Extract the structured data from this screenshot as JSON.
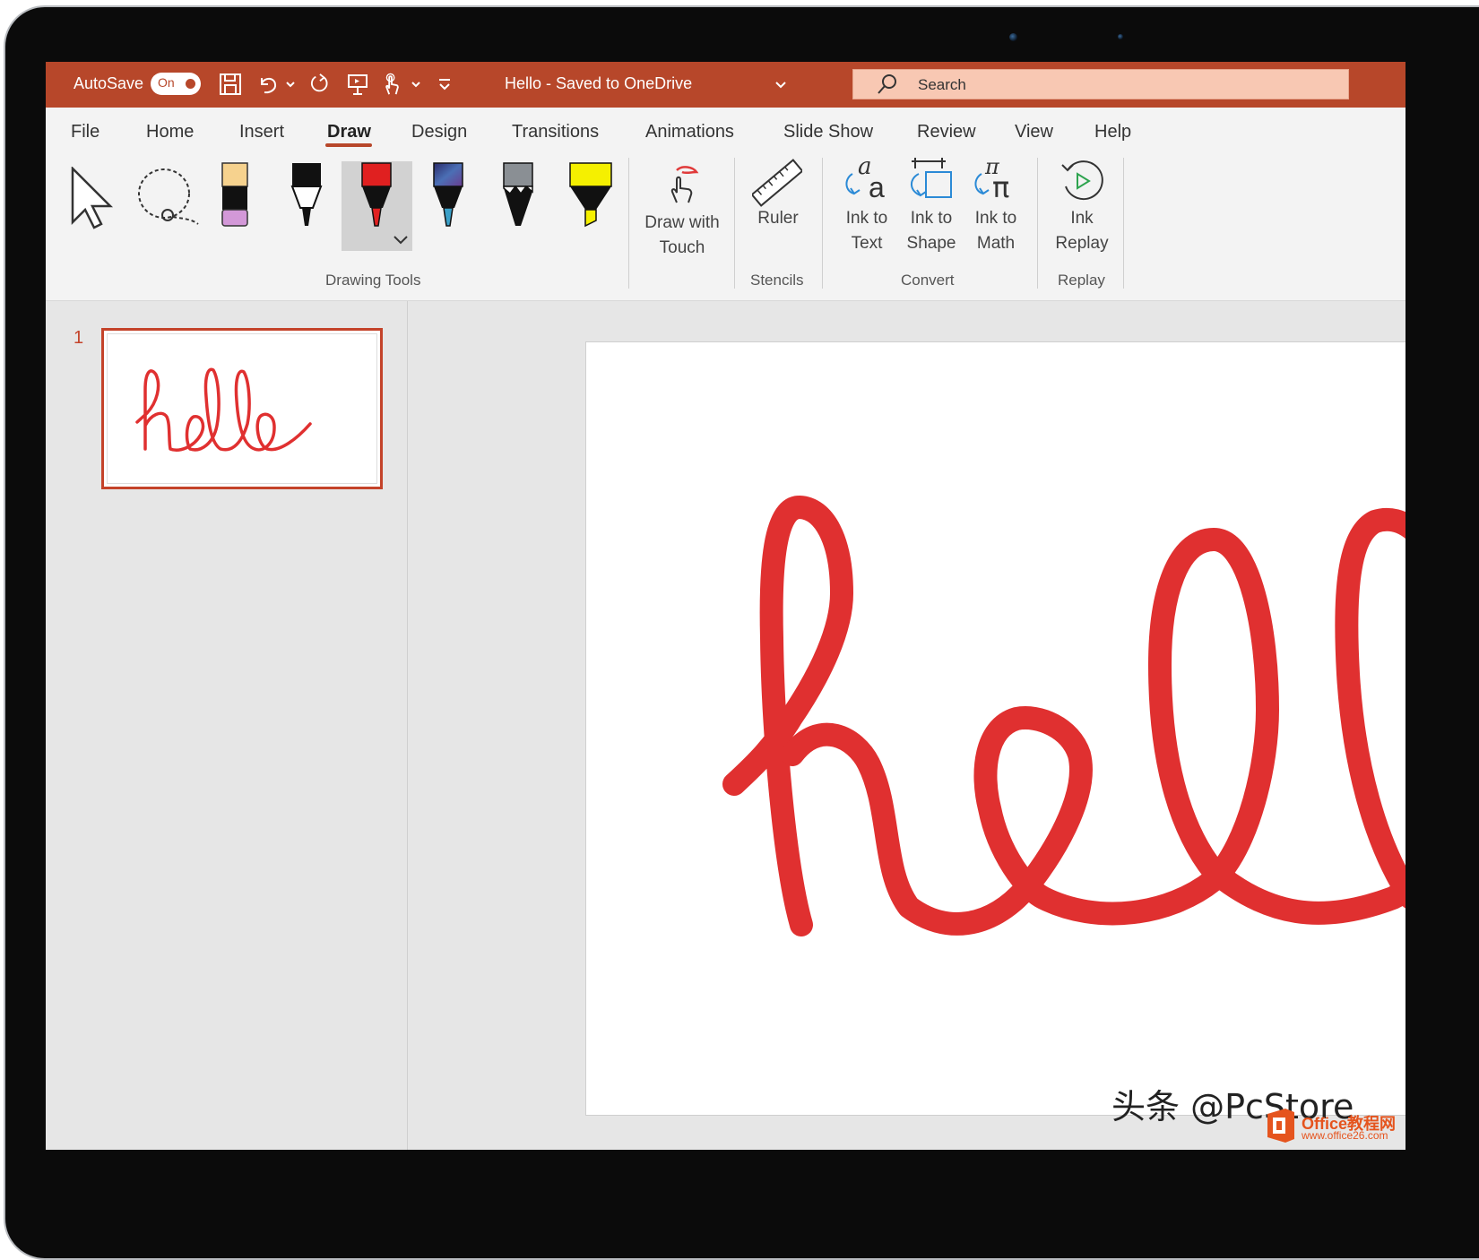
{
  "titlebar": {
    "autosave_label": "AutoSave",
    "autosave_state": "On",
    "document_title": "Hello - Saved to OneDrive",
    "search_placeholder": "Search",
    "quick_access": [
      "save-icon",
      "undo-icon",
      "redo-icon",
      "present-icon",
      "touch-mode-icon",
      "customize-icon"
    ]
  },
  "ribbon": {
    "tabs": [
      "File",
      "Home",
      "Insert",
      "Draw",
      "Design",
      "Transitions",
      "Animations",
      "Slide Show",
      "Review",
      "View",
      "Help"
    ],
    "active_tab": "Draw",
    "draw_with_touch": "Draw with Touch",
    "draw_with_touch_lines": [
      "Draw with",
      "Touch"
    ],
    "ruler": "Ruler",
    "ink_to_text": [
      "Ink to",
      "Text"
    ],
    "ink_to_shape": [
      "Ink to",
      "Shape"
    ],
    "ink_to_math": [
      "Ink to",
      "Math"
    ],
    "ink_replay": [
      "Ink",
      "Replay"
    ],
    "groups": {
      "drawing_tools": "Drawing Tools",
      "stencils": "Stencils",
      "convert": "Convert",
      "replay": "Replay"
    }
  },
  "slides_panel": {
    "slide_number": "1",
    "thumbnail_ink_text": "hello"
  },
  "slide": {
    "ink_text": "hello"
  },
  "watermark": {
    "text": "头条 @PcStore",
    "logo_name": "Office教程网",
    "logo_url": "www.office26.com"
  },
  "colors": {
    "accent": "#b7472a",
    "ink": "#e03030",
    "search_bg": "#f8c8b3"
  }
}
